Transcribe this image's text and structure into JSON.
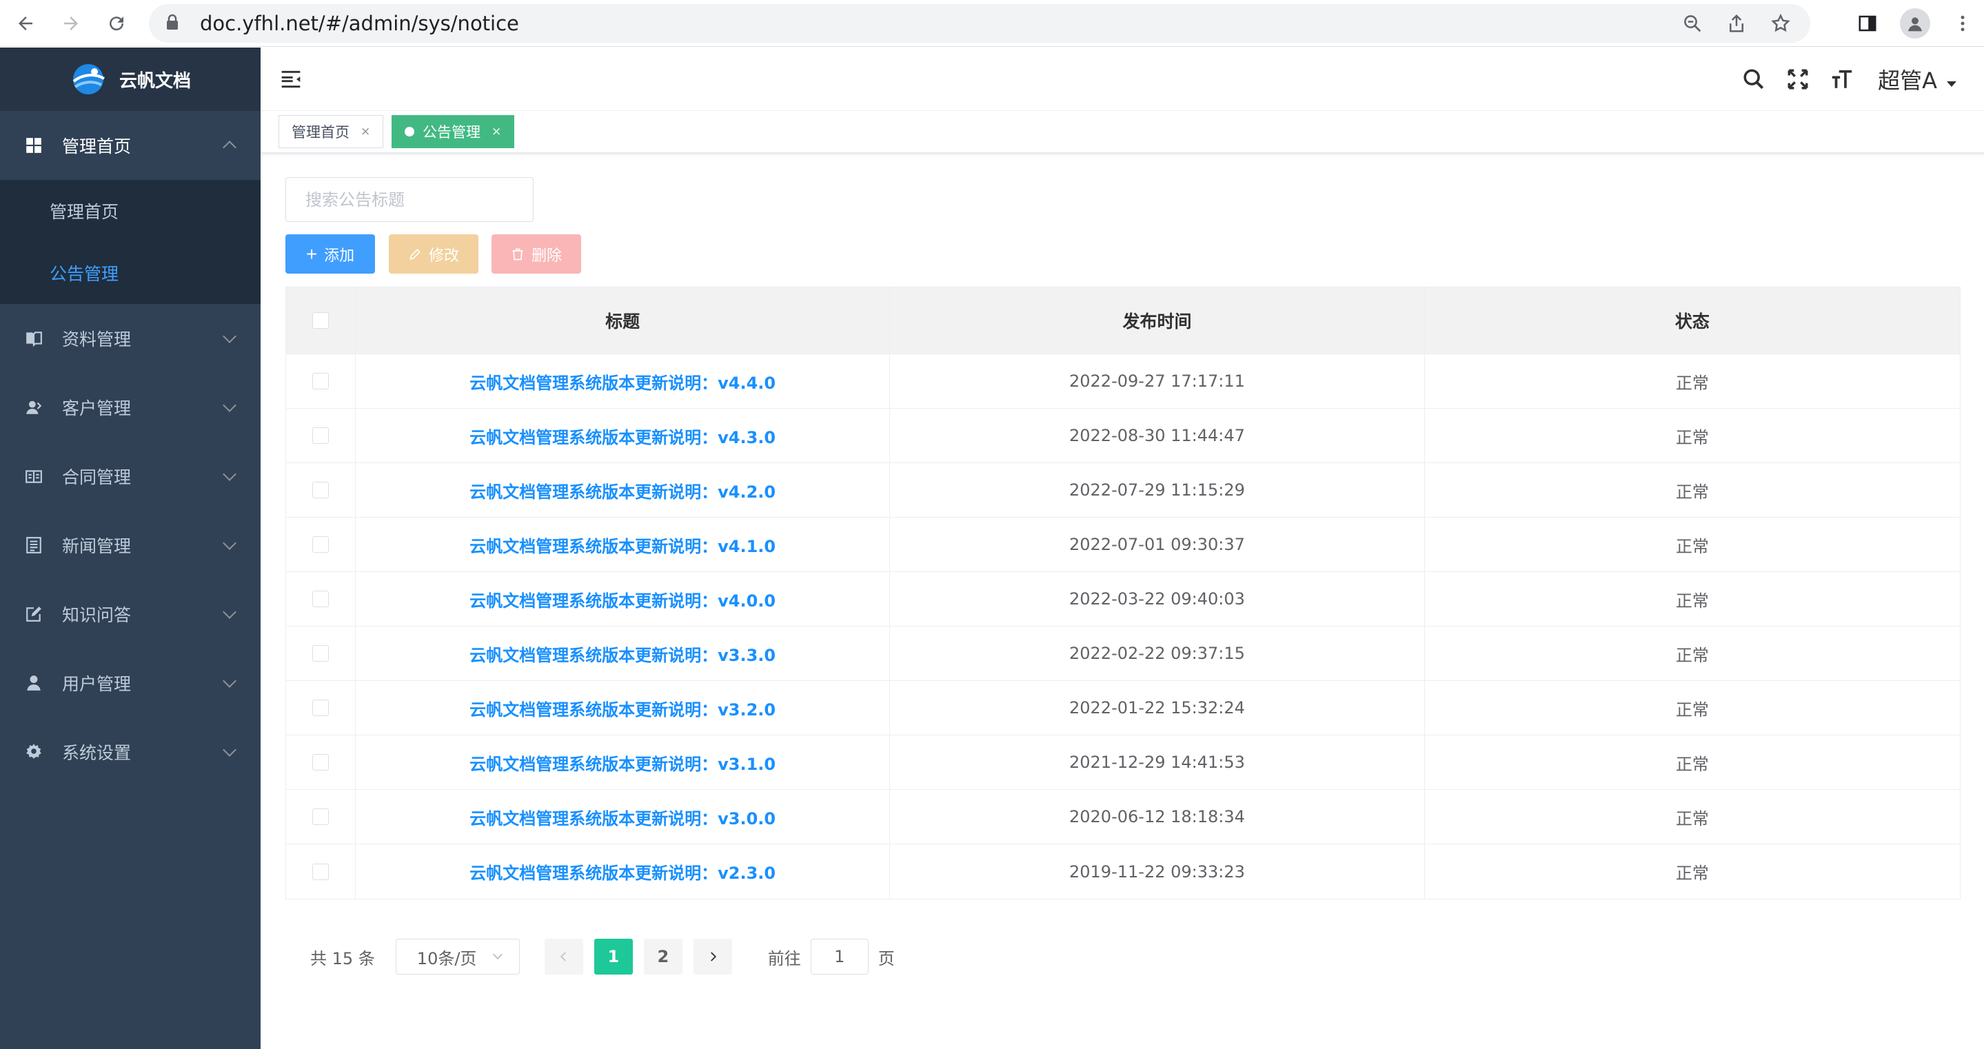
{
  "browser": {
    "url": "doc.yfhl.net/#/admin/sys/notice"
  },
  "brand": {
    "name": "云帆文档"
  },
  "sidebar": {
    "items": [
      {
        "label": "管理首页",
        "icon": "dashboard-icon",
        "open": true,
        "children": [
          {
            "label": "管理首页"
          },
          {
            "label": "公告管理",
            "active": true
          }
        ]
      },
      {
        "label": "资料管理",
        "icon": "book-icon"
      },
      {
        "label": "客户管理",
        "icon": "customer-icon"
      },
      {
        "label": "合同管理",
        "icon": "contract-icon"
      },
      {
        "label": "新闻管理",
        "icon": "news-icon"
      },
      {
        "label": "知识问答",
        "icon": "edit-icon"
      },
      {
        "label": "用户管理",
        "icon": "user-icon"
      },
      {
        "label": "系统设置",
        "icon": "gear-icon"
      }
    ]
  },
  "navbar": {
    "user": "超管A"
  },
  "tags": [
    {
      "label": "管理首页",
      "active": false
    },
    {
      "label": "公告管理",
      "active": true
    }
  ],
  "search": {
    "placeholder": "搜索公告标题",
    "value": ""
  },
  "toolbar": {
    "add_label": "添加",
    "edit_label": "修改",
    "delete_label": "删除"
  },
  "table": {
    "columns": [
      "标题",
      "发布时间",
      "状态"
    ],
    "rows": [
      {
        "title": "云帆文档管理系统版本更新说明：v4.4.0",
        "time": "2022-09-27 17:17:11",
        "status": "正常"
      },
      {
        "title": "云帆文档管理系统版本更新说明：v4.3.0",
        "time": "2022-08-30 11:44:47",
        "status": "正常"
      },
      {
        "title": "云帆文档管理系统版本更新说明：v4.2.0",
        "time": "2022-07-29 11:15:29",
        "status": "正常"
      },
      {
        "title": "云帆文档管理系统版本更新说明：v4.1.0",
        "time": "2022-07-01 09:30:37",
        "status": "正常"
      },
      {
        "title": "云帆文档管理系统版本更新说明：v4.0.0",
        "time": "2022-03-22 09:40:03",
        "status": "正常"
      },
      {
        "title": "云帆文档管理系统版本更新说明：v3.3.0",
        "time": "2022-02-22 09:37:15",
        "status": "正常"
      },
      {
        "title": "云帆文档管理系统版本更新说明：v3.2.0",
        "time": "2022-01-22 15:32:24",
        "status": "正常"
      },
      {
        "title": "云帆文档管理系统版本更新说明：v3.1.0",
        "time": "2021-12-29 14:41:53",
        "status": "正常"
      },
      {
        "title": "云帆文档管理系统版本更新说明：v3.0.0",
        "time": "2020-06-12 18:18:34",
        "status": "正常"
      },
      {
        "title": "云帆文档管理系统版本更新说明：v2.3.0",
        "time": "2019-11-22 09:33:23",
        "status": "正常"
      }
    ]
  },
  "pagination": {
    "total_text": "共 15 条",
    "page_size": "10条/页",
    "pages": [
      "1",
      "2"
    ],
    "current": "1",
    "goto_prefix": "前往",
    "goto_value": "1",
    "goto_suffix": "页"
  },
  "colors": {
    "sidebar_bg": "#304156",
    "primary": "#409eff",
    "tag_active": "#42b983",
    "page_active": "#1ec898",
    "link": "#1890ff"
  }
}
